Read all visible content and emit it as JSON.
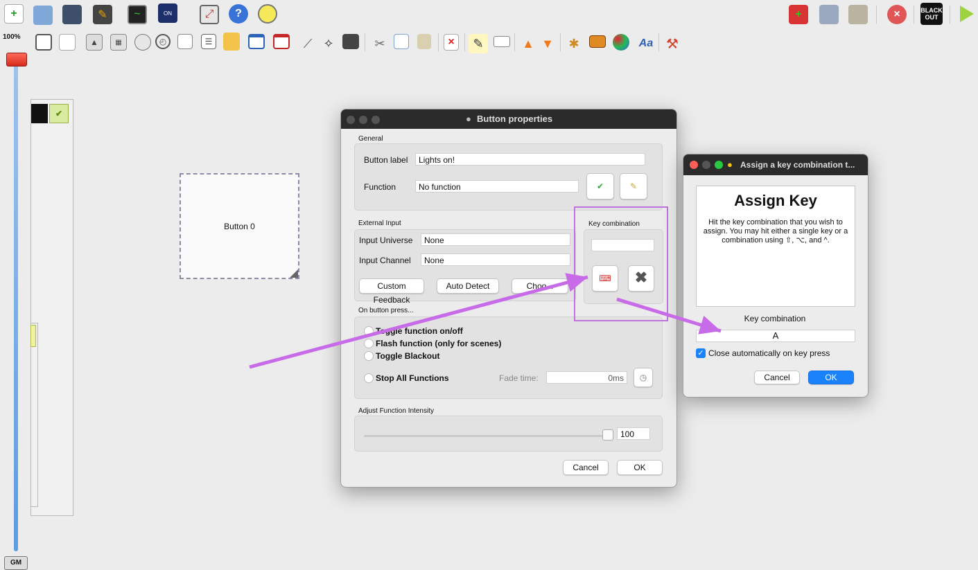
{
  "toolbar": {
    "top_icons": [
      "new-file-icon",
      "open-folder-icon",
      "save-icon",
      "edit-icon",
      "monitor-icon",
      "dmx-icon",
      "fullscreen-icon",
      "help-icon",
      "about-icon"
    ],
    "top_right_icons": [
      "fixtures-add-icon",
      "function-wizard-icon",
      "tools-icon",
      "stop-all-icon",
      "blackout-icon",
      "play-icon"
    ],
    "blackout_label": "BLACK OUT",
    "second_icons": [
      "frame-icon",
      "grid-icon",
      "slider-icon",
      "xy-pad-icon",
      "speed-dial-icon",
      "clock-icon",
      "matrix-icon",
      "list-icon",
      "cue-list-icon",
      "frame-window-icon",
      "solo-frame-icon",
      "audio-triggers-icon",
      "animation-icon",
      "label-icon",
      "cut-icon",
      "copy-icon",
      "paste-icon",
      "delete-icon",
      "edit-widget-icon",
      "rename-icon",
      "bring-front-icon",
      "send-back-icon",
      "widget-props-icon",
      "bg-image-icon",
      "color-icon",
      "font-icon",
      "settings-icon"
    ]
  },
  "master": {
    "zoom": "100%",
    "gm_label": "GM"
  },
  "workspace": {
    "button_label": "Button 0"
  },
  "button_properties": {
    "title": "Button properties",
    "general_header": "General",
    "button_label_label": "Button label",
    "button_label_value": "Lights on!",
    "function_label": "Function",
    "function_value": "No function",
    "external_input_header": "External Input",
    "input_universe_label": "Input Universe",
    "input_universe_value": "None",
    "input_channel_label": "Input Channel",
    "input_channel_value": "None",
    "custom_feedback": "Custom Feedback",
    "auto_detect": "Auto Detect",
    "choose": "Choo...",
    "key_combination_header": "Key combination",
    "key_combination_value": "",
    "on_press_header": "On button press...",
    "options": [
      "Toggle function on/off",
      "Flash function (only for scenes)",
      "Toggle Blackout",
      "Stop All Functions"
    ],
    "fade_time_label": "Fade time:",
    "fade_time_value": "0ms",
    "intensity_header": "Adjust Function Intensity",
    "intensity_value": "100",
    "intensity_fraction": 1.0,
    "cancel": "Cancel",
    "ok": "OK"
  },
  "assign_key": {
    "title": "Assign a key combination t...",
    "heading": "Assign Key",
    "description": "Hit the key combination that you wish to assign. You may hit either a single key or a combination using ⇧, ⌥, and ^.",
    "key_combination_label": "Key combination",
    "key_combination_value": "A",
    "close_auto_label": "Close automatically on key press",
    "close_auto_checked": true,
    "cancel": "Cancel",
    "ok": "OK"
  },
  "colors": {
    "annotation": "#c86be8",
    "accent": "#1a82fb"
  }
}
